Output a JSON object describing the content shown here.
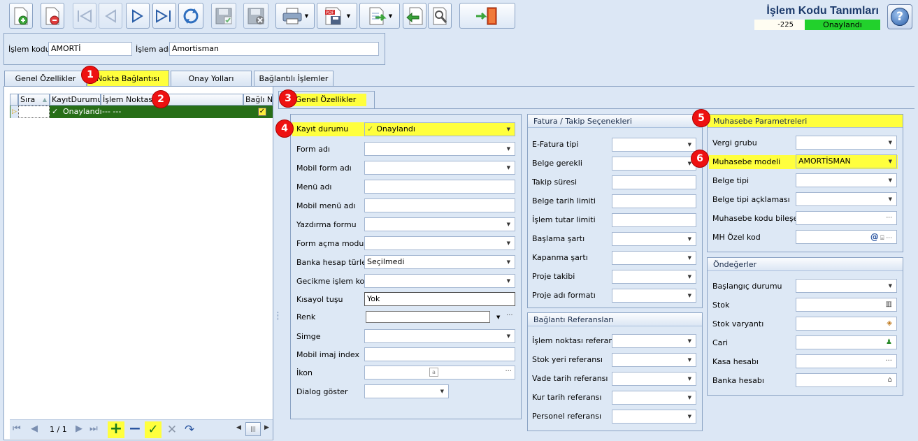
{
  "toolbar": {
    "buttons": [
      "new-icon",
      "delete-icon",
      "first-record-icon",
      "previous-record-icon",
      "next-record-icon",
      "last-record-icon",
      "refresh-icon",
      "save-icon",
      "save-close-icon",
      "print-icon",
      "pdf-export-icon",
      "import-icon",
      "back-icon",
      "tools-icon",
      "exit-icon"
    ]
  },
  "window": {
    "title": "İşlem Kodu Tanımları",
    "record_code": "-225",
    "record_status": "Onaylandı",
    "status_color": "#22d12c"
  },
  "header": {
    "code_label": "İşlem kodu",
    "code_value": "AMORTİ",
    "name_label": "İşlem adı",
    "name_value": "Amortisman"
  },
  "tabs": [
    "Genel Özellikler",
    "Nokta Bağlantısı",
    "Onay Yolları",
    "Bağlantılı İşlemler"
  ],
  "grid": {
    "columns": [
      "Sıra",
      "KayıtDurumu",
      "İşlem Noktası",
      "Bağlı Nok"
    ],
    "rows": [
      {
        "sira": "",
        "durum": "Onaylandı",
        "nokta": "--- ---",
        "bagli": true
      }
    ],
    "pager": "1 / 1"
  },
  "subtab": "Genel Özellikler",
  "general": {
    "fields": [
      {
        "label": "Kayıt durumu",
        "value": "Onaylandı"
      },
      {
        "label": "Form adı",
        "value": ""
      },
      {
        "label": "Mobil form adı",
        "value": ""
      },
      {
        "label": "Menü adı",
        "value": ""
      },
      {
        "label": "Mobil menü adı",
        "value": ""
      },
      {
        "label": "Yazdırma formu",
        "value": ""
      },
      {
        "label": "Form açma modu",
        "value": ""
      },
      {
        "label": "Banka hesap türleri",
        "value": "Seçilmedi"
      },
      {
        "label": "Gecikme işlem kodu",
        "value": ""
      },
      {
        "label": "Kısayol tuşu",
        "value": "Yok"
      },
      {
        "label": "Renk",
        "value": ""
      },
      {
        "label": "Simge",
        "value": ""
      },
      {
        "label": "Mobil imaj index",
        "value": ""
      },
      {
        "label": "İkon",
        "value": ""
      },
      {
        "label": "Dialog göster",
        "value": ""
      }
    ]
  },
  "invoice": {
    "title": "Fatura / Takip Seçenekleri",
    "fields": [
      "E-Fatura tipi",
      "Belge gerekli",
      "Takip süresi",
      "Belge tarih limiti",
      "İşlem tutar limiti",
      "Başlama şartı",
      "Kapanma şartı",
      "Proje takibi",
      "Proje adı formatı"
    ]
  },
  "references": {
    "title": "Bağlantı Referansları",
    "fields": [
      "İşlem noktası referansı",
      "Stok yeri referansı",
      "Vade tarih referansı",
      "Kur tarih referansı",
      "Personel referansı"
    ]
  },
  "accounting": {
    "title": "Muhasebe Parametreleri",
    "fields": [
      {
        "label": "Vergi grubu",
        "value": ""
      },
      {
        "label": "Muhasebe modeli",
        "value": "AMORTİSMAN"
      },
      {
        "label": "Belge tipi",
        "value": ""
      },
      {
        "label": "Belge tipi açklaması",
        "value": ""
      },
      {
        "label": "Muhasebe kodu bileşeni",
        "value": ""
      },
      {
        "label": "MH Özel kod",
        "value": ""
      }
    ]
  },
  "defaults": {
    "title": "Öndeğerler",
    "fields": [
      "Başlangıç durumu",
      "Stok",
      "Stok varyantı",
      "Cari",
      "Kasa hesabı",
      "Banka hesabı"
    ]
  },
  "badges": [
    "1",
    "2",
    "3",
    "4",
    "5",
    "6"
  ],
  "highlight_color": "#ffff3d"
}
